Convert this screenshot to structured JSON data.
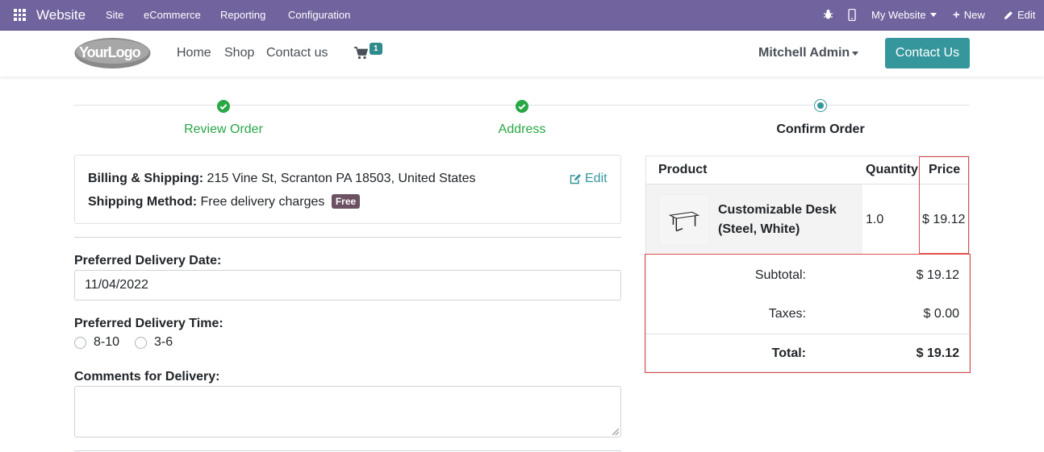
{
  "topbar": {
    "brand": "Website",
    "menus": [
      "Site",
      "eCommerce",
      "Reporting",
      "Configuration"
    ],
    "website_selector": "My Website",
    "new_label": "New",
    "edit_label": "Edit"
  },
  "header": {
    "logo_text": "YourLogo",
    "nav": [
      "Home",
      "Shop",
      "Contact us"
    ],
    "cart_count": "1",
    "user": "Mitchell Admin",
    "contact_button": "Contact Us"
  },
  "wizard": {
    "steps": [
      {
        "label": "Review Order",
        "state": "done"
      },
      {
        "label": "Address",
        "state": "done"
      },
      {
        "label": "Confirm Order",
        "state": "current"
      }
    ]
  },
  "billing": {
    "address_label": "Billing & Shipping:",
    "address": "215 Vine St, Scranton PA 18503, United States",
    "method_label": "Shipping Method:",
    "method": "Free delivery charges",
    "method_badge": "Free",
    "edit_label": "Edit"
  },
  "delivery": {
    "date_label": "Preferred Delivery Date:",
    "date_value": "11/04/2022",
    "time_label": "Preferred Delivery Time:",
    "time_options": [
      "8-10",
      "3-6"
    ],
    "comments_label": "Comments for Delivery:",
    "comments_value": ""
  },
  "order": {
    "headers": {
      "product": "Product",
      "quantity": "Quantity",
      "price": "Price"
    },
    "items": [
      {
        "name": "Customizable Desk (Steel, White)",
        "quantity": "1.0",
        "price": "$ 19.12"
      }
    ],
    "subtotal_label": "Subtotal:",
    "subtotal": "$ 19.12",
    "taxes_label": "Taxes:",
    "taxes": "$ 0.00",
    "total_label": "Total:",
    "total": "$ 19.12"
  },
  "colors": {
    "admin_bar": "#71639e",
    "primary": "#35979c",
    "success": "#28a745",
    "highlight": "#e04b4b"
  }
}
